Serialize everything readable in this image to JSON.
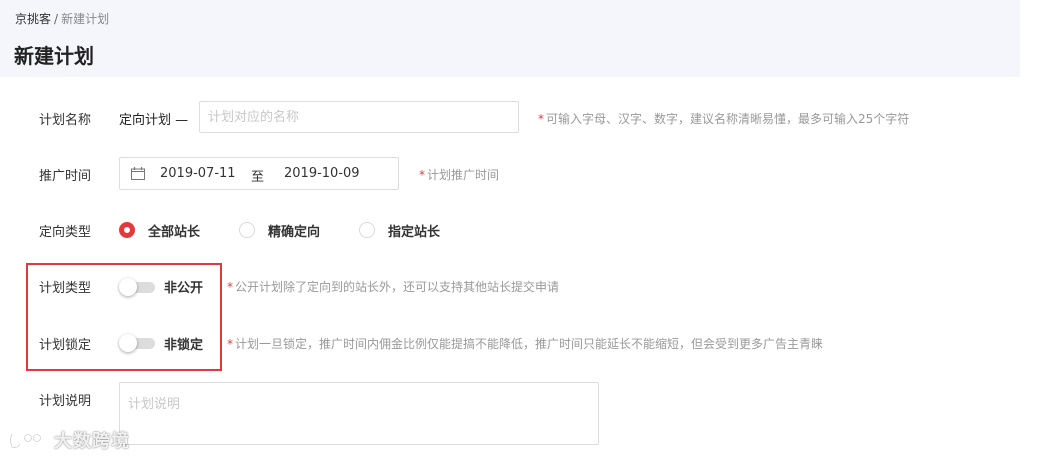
{
  "breadcrumb": {
    "root": "京挑客",
    "separator": "/",
    "current": "新建计划"
  },
  "page_title": "新建计划",
  "form": {
    "plan_name": {
      "label": "计划名称",
      "prefix": "定向计划 —",
      "placeholder": "计划对应的名称",
      "value": "",
      "hint": "可输入字母、汉字、数字，建议名称清晰易懂，最多可输入25个字符"
    },
    "promo_time": {
      "label": "推广时间",
      "start": "2019-07-11",
      "to": "至",
      "end": "2019-10-09",
      "hint": "计划推广时间"
    },
    "target_type": {
      "label": "定向类型",
      "options": [
        {
          "label": "全部站长",
          "checked": true
        },
        {
          "label": "精确定向",
          "checked": false
        },
        {
          "label": "指定站长",
          "checked": false
        }
      ]
    },
    "plan_type": {
      "label": "计划类型",
      "switch_on": false,
      "switch_text": "非公开",
      "hint": "公开计划除了定向到的站长外，还可以支持其他站长提交申请"
    },
    "plan_lock": {
      "label": "计划锁定",
      "switch_on": false,
      "switch_text": "非锁定",
      "hint": "计划一旦锁定，推广时间内佣金比例仅能提搞不能降低，推广时间只能延长不能缩短，但会受到更多广告主青睐"
    },
    "plan_desc": {
      "label": "计划说明",
      "placeholder": "计划说明",
      "value": ""
    }
  },
  "required_mark": "*",
  "watermark": {
    "text": "大数跨境",
    "icon": "watermark-logo-icon"
  },
  "colors": {
    "accent": "#e4393c",
    "header_bg": "#f4f6fc",
    "hint": "#999999"
  }
}
